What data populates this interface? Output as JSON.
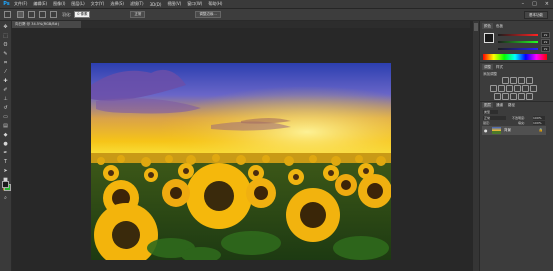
{
  "app": {
    "logo": "Ps"
  },
  "menu": {
    "items": [
      "文件(F)",
      "编辑(E)",
      "图像(I)",
      "图层(L)",
      "文字(Y)",
      "选择(S)",
      "滤镜(T)",
      "3D(D)",
      "视图(V)",
      "窗口(W)",
      "帮助(H)"
    ]
  },
  "window_controls": {
    "minimize": "–",
    "restore": "□",
    "close": "×"
  },
  "options_bar": {
    "feather_label": "羽化:",
    "feather_value": "0 像素",
    "style_value": "正常",
    "refine_button": "调整边缘...",
    "workspace": "基本功能"
  },
  "document": {
    "tab_title": "向日葵 @ 34.5%(RGB/8#)"
  },
  "tools": {
    "items": [
      {
        "name": "move-tool",
        "glyph": "✥"
      },
      {
        "name": "marquee-tool",
        "glyph": "⬚"
      },
      {
        "name": "lasso-tool",
        "glyph": "ʘ"
      },
      {
        "name": "quick-select-tool",
        "glyph": "✎"
      },
      {
        "name": "crop-tool",
        "glyph": "⌗"
      },
      {
        "name": "eyedropper-tool",
        "glyph": "⁄"
      },
      {
        "name": "healing-brush-tool",
        "glyph": "✚"
      },
      {
        "name": "brush-tool",
        "glyph": "✐"
      },
      {
        "name": "clone-stamp-tool",
        "glyph": "⊥"
      },
      {
        "name": "history-brush-tool",
        "glyph": "↺"
      },
      {
        "name": "eraser-tool",
        "glyph": "▭"
      },
      {
        "name": "gradient-tool",
        "glyph": "▤"
      },
      {
        "name": "blur-tool",
        "glyph": "◆"
      },
      {
        "name": "dodge-tool",
        "glyph": "●"
      },
      {
        "name": "pen-tool",
        "glyph": "✒"
      },
      {
        "name": "type-tool",
        "glyph": "T"
      },
      {
        "name": "path-select-tool",
        "glyph": "➤"
      },
      {
        "name": "shape-tool",
        "glyph": "■"
      },
      {
        "name": "hand-tool",
        "glyph": "✋"
      },
      {
        "name": "zoom-tool",
        "glyph": "⌕"
      }
    ],
    "foreground_color": "#1a1a1a",
    "background_color": "#26b32f"
  },
  "color_panel": {
    "tabs": [
      "颜色",
      "色板"
    ],
    "r": "29",
    "g": "29",
    "b": "29"
  },
  "adjustments_panel": {
    "tabs": [
      "调整",
      "样式"
    ],
    "title": "添加调整"
  },
  "layers_panel": {
    "tabs": [
      "图层",
      "通道",
      "路径"
    ],
    "filter_label": "类型",
    "blend_mode": "正常",
    "opacity_label": "不透明度:",
    "opacity_value": "100%",
    "lock_label": "锁定:",
    "fill_label": "填充:",
    "fill_value": "100%",
    "layer": {
      "name": "背景",
      "eye": "●",
      "lock": "🔒"
    }
  },
  "colors": {
    "menubar": "#3a3a3a",
    "workspace": "#282828",
    "panel": "#3c3c3c",
    "selected_layer": "#505050"
  }
}
